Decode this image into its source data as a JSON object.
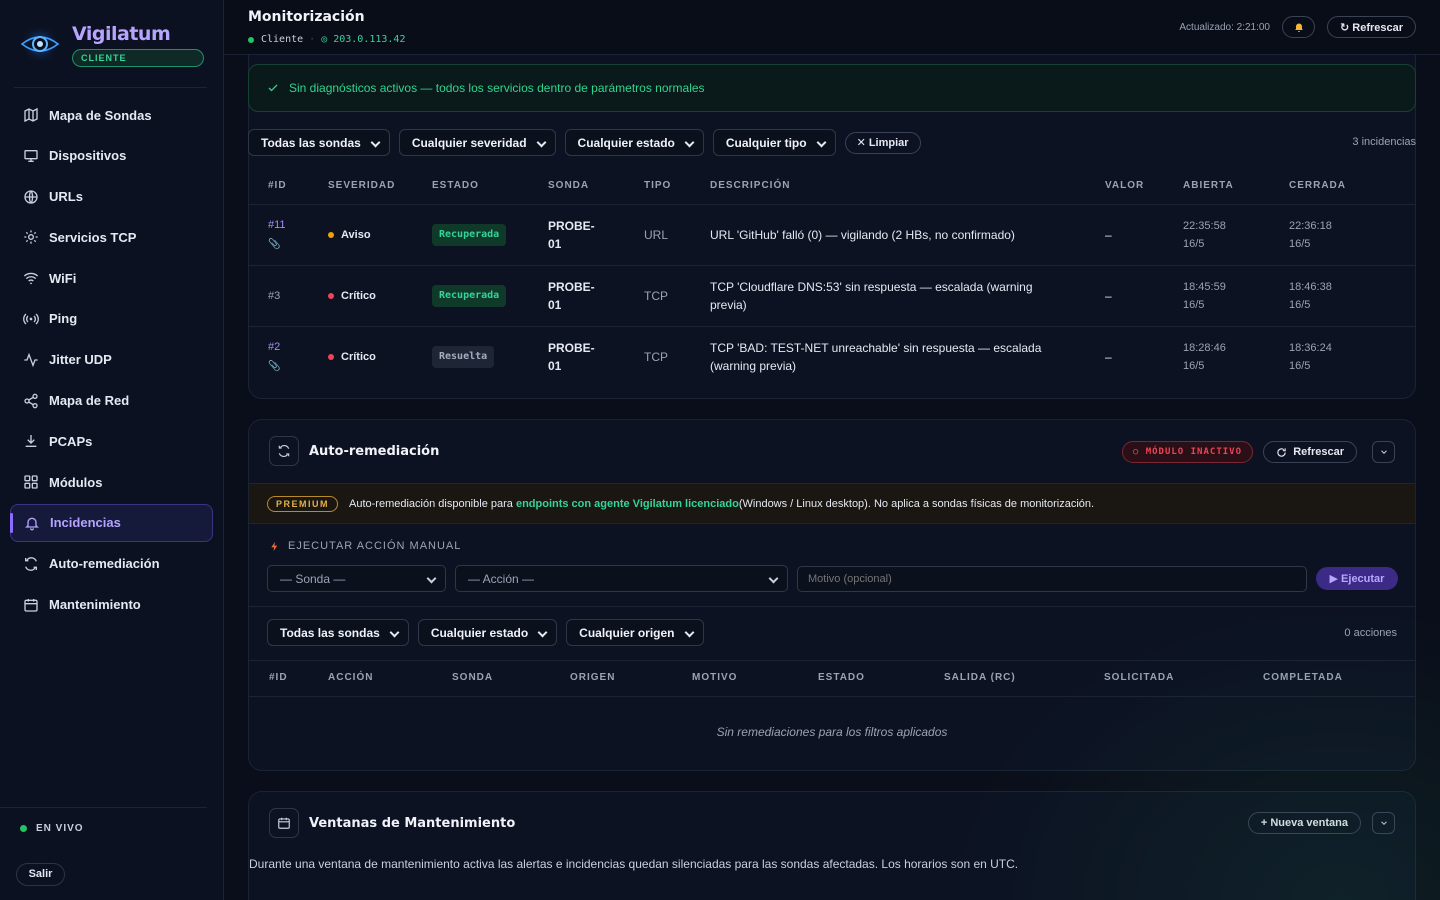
{
  "brand": {
    "name": "Vigilatum",
    "badge": "CLIENTE"
  },
  "nav": [
    {
      "label": "Mapa de Sondas",
      "icon": "map-icon"
    },
    {
      "label": "Dispositivos",
      "icon": "monitor-icon"
    },
    {
      "label": "URLs",
      "icon": "globe-icon"
    },
    {
      "label": "Servicios TCP",
      "icon": "sun-icon"
    },
    {
      "label": "WiFi",
      "icon": "wifi-icon"
    },
    {
      "label": "Ping",
      "icon": "radio-icon"
    },
    {
      "label": "Jitter UDP",
      "icon": "activity-icon"
    },
    {
      "label": "Mapa de Red",
      "icon": "share-icon"
    },
    {
      "label": "PCAPs",
      "icon": "download-icon"
    },
    {
      "label": "Módulos",
      "icon": "grid-icon"
    },
    {
      "label": "Incidencias",
      "icon": "bell-icon",
      "active": true
    },
    {
      "label": "Auto-remediación",
      "icon": "refresh-icon"
    },
    {
      "label": "Mantenimiento",
      "icon": "calendar-icon"
    }
  ],
  "footer": {
    "live": "EN VIVO",
    "logout": "Salir"
  },
  "header": {
    "title": "Monitorización",
    "client": "Cliente",
    "ip": "◎ 203.0.113.42",
    "updated": "Actualizado: 2:21:00",
    "refresh": "↻ Refrescar"
  },
  "incidents": {
    "banner": "Sin diagnósticos activos — todos los servicios dentro de parámetros normales",
    "filters": [
      "Todas las sondas",
      "Cualquier severidad",
      "Cualquier estado",
      "Cualquier tipo"
    ],
    "clear": "✕ Limpiar",
    "count": "3 incidencias",
    "columns": [
      "#ID",
      "SEVERIDAD",
      "ESTADO",
      "SONDA",
      "TIPO",
      "DESCRIPCIÓN",
      "VALOR",
      "ABIERTA",
      "CERRADA"
    ],
    "rows": [
      {
        "id": "#11",
        "clip": true,
        "severity": "Aviso",
        "sevColor": "#f59e0b",
        "state": "Recuperada",
        "stateKind": "green",
        "probe": "PROBE-01",
        "type": "URL",
        "desc": "URL 'GitHub' falló (0) — vigilando (2 HBs, no confirmado)",
        "value": "–",
        "opened": "22:35:58 16/5",
        "closed": "22:36:18 16/5"
      },
      {
        "id": "#3",
        "clip": false,
        "severity": "Crítico",
        "sevColor": "#ef4458",
        "state": "Recuperada",
        "stateKind": "green",
        "probe": "PROBE-01",
        "type": "TCP",
        "desc": "TCP 'Cloudflare DNS:53' sin respuesta — escalada (warning previa)",
        "value": "–",
        "opened": "18:45:59 16/5",
        "closed": "18:46:38 16/5"
      },
      {
        "id": "#2",
        "clip": true,
        "severity": "Crítico",
        "sevColor": "#ef4458",
        "state": "Resuelta",
        "stateKind": "gray",
        "probe": "PROBE-01",
        "type": "TCP",
        "desc": "TCP 'BAD: TEST-NET unreachable' sin respuesta — escalada (warning previa)",
        "value": "–",
        "opened": "18:28:46 16/5",
        "closed": "18:36:24 16/5"
      }
    ]
  },
  "remediation": {
    "title": "Auto-remediación",
    "inactive": "○ MÓDULO INACTIVO",
    "refresh": "Refrescar",
    "premium_tag": "PREMIUM",
    "premium_pre": "Auto-remediación disponible para ",
    "premium_hl": "endpoints con agente Vigilatum licenciado",
    "premium_post": " (Windows / Linux desktop). No aplica a sondas físicas de monitorización.",
    "manual_label": "EJECUTAR ACCIÓN MANUAL",
    "probe_select": "— Sonda —",
    "action_select": "— Acción —",
    "motive_placeholder": "Motivo (opcional)",
    "execute": "▶ Ejecutar",
    "filters": [
      "Todas las sondas",
      "Cualquier estado",
      "Cualquier origen"
    ],
    "count": "0 acciones",
    "columns": [
      "#ID",
      "ACCIÓN",
      "SONDA",
      "ORIGEN",
      "MOTIVO",
      "ESTADO",
      "SALIDA (RC)",
      "SOLICITADA",
      "COMPLETADA"
    ],
    "empty": "Sin remediaciones para los filtros aplicados"
  },
  "maintenance": {
    "title": "Ventanas de Mantenimiento",
    "new": "+ Nueva ventana",
    "desc": "Durante una ventana de mantenimiento activa las alertas e incidencias quedan silenciadas para las sondas afectadas. Los horarios son en UTC."
  },
  "colors": {
    "accent": "#8b6cff",
    "success": "#22c55e",
    "danger": "#ef4458",
    "warning": "#f59e0b"
  }
}
